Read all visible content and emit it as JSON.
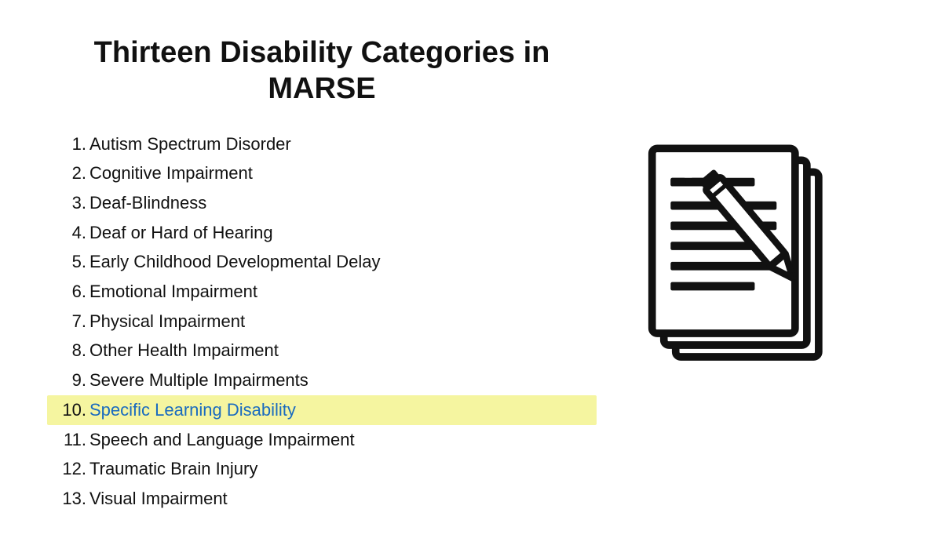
{
  "title": "Thirteen Disability Categories in MARSE",
  "items": [
    {
      "number": "1.",
      "text": "Autism Spectrum Disorder",
      "highlighted": false
    },
    {
      "number": "2.",
      "text": "Cognitive Impairment",
      "highlighted": false
    },
    {
      "number": "3.",
      "text": "Deaf-Blindness",
      "highlighted": false
    },
    {
      "number": "4.",
      "text": "Deaf or Hard of Hearing",
      "highlighted": false
    },
    {
      "number": "5.",
      "text": "Early Childhood Developmental Delay",
      "highlighted": false
    },
    {
      "number": "6.",
      "text": "Emotional Impairment",
      "highlighted": false
    },
    {
      "number": "7.",
      "text": "Physical Impairment",
      "highlighted": false
    },
    {
      "number": "8.",
      "text": "Other Health Impairment",
      "highlighted": false
    },
    {
      "number": "9.",
      "text": "Severe Multiple Impairments",
      "highlighted": false
    },
    {
      "number": "10.",
      "text": "Specific Learning Disability",
      "highlighted": true
    },
    {
      "number": "11.",
      "text": "Speech and Language Impairment",
      "highlighted": false
    },
    {
      "number": "12.",
      "text": "Traumatic Brain Injury",
      "highlighted": false
    },
    {
      "number": "13.",
      "text": "Visual Impairment",
      "highlighted": false
    }
  ]
}
